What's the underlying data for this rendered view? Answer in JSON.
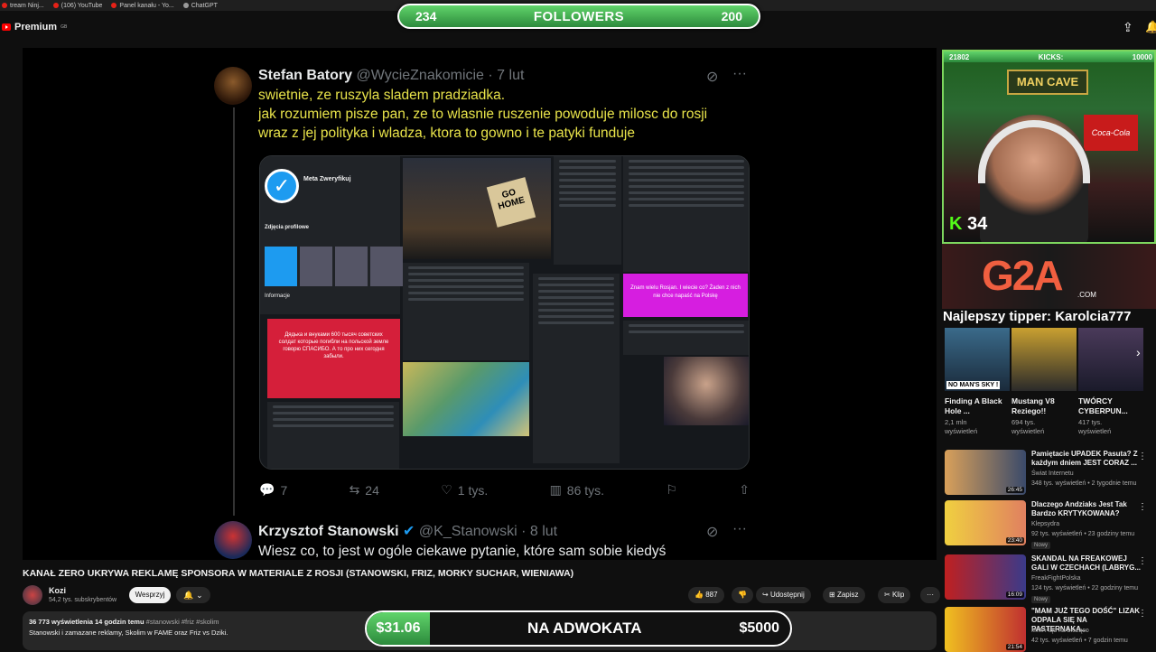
{
  "bookmarks": [
    "tream Ninj...",
    "(106) YouTube",
    "Panel kanału - Yo...",
    "ChatGPT"
  ],
  "header": {
    "logo": "Premium",
    "region": "GB"
  },
  "followers_goal": {
    "current": "234",
    "label": "FOLLOWERS",
    "target": "200"
  },
  "tweets": [
    {
      "name": "Stefan Batory",
      "handle": "@WycieZnakomicie · 7 lut",
      "lines": [
        "swietnie, ze ruszyla sladem pradziadka.",
        "jak rozumiem pisze pan, ze to wlasnie ruszenie powoduje milosc do rosji",
        "wraz z jej polityka i wladza, ktora to gowno i te patyki funduje"
      ],
      "stats": {
        "replies": "7",
        "retweets": "24",
        "likes": "1 tys.",
        "views": "86 tys."
      }
    },
    {
      "name": "Krzysztof Stanowski",
      "handle": "@K_Stanowski · 8 lut",
      "lines": [
        "Wiesz co, to jest w ogóle ciekawe pytanie, które sam sobie kiedyś"
      ]
    }
  ],
  "media": {
    "profile_name": "Meta Zweryfikuj",
    "section": "Zdjęcia profilowe",
    "info": "Informacje",
    "sign": "GO HOME",
    "red_text": "Дядька и внуками 600 тысяч советских солдат которые погибли на польской земле говорю СПАСИБО. А то про них сегодня забыли.",
    "magenta_text": "Znam wielu Rosjan. I wiecie co? Żaden z nich nie chce napaść na Polskę"
  },
  "video": {
    "title": "KANAŁ ZERO UKRYWA REKLAMĘ SPONSORA W MATERIALE Z ROSJI (STANOWSKI, FRIZ, MORKY SUCHAR, WIENIAWA)",
    "channel": "Kozi",
    "subs": "54,2 tys. subskrybentów",
    "support": "Wesprzyj",
    "likes": "887",
    "share": "Udostępnij",
    "save": "Zapisz",
    "clip": "Klip",
    "views": "36 773 wyświetlenia  14 godzin temu",
    "tags": "#stanowski #friz #skolim",
    "desc": "Stanowski i zamazane reklamy, Skolim w FAME oraz Friz vs Dziki."
  },
  "donation": {
    "current": "$31.06",
    "label": "NA ADWOKATA",
    "goal": "$5000"
  },
  "stream": {
    "kicks_left": "21802",
    "kicks_label": "KICKS:",
    "kicks_goal": "10000",
    "mancave": "MAN CAVE",
    "cola": "Coca-Cola",
    "kick_count": "34",
    "g2a": "G2A",
    "g2a_com": ".COM",
    "top_tipper": "Najlepszy tipper: Karolcia777"
  },
  "recommended": [
    {
      "title": "Finding A Black Hole ...",
      "meta1": "2,1 mln",
      "meta2": "wyświetleń",
      "badge": "NO MAN'S SKY !"
    },
    {
      "title": "Mustang V8 Reziego!!",
      "meta1": "694 tys.",
      "meta2": "wyświetleń"
    },
    {
      "title": "TWÓRCY CYBERPUN...",
      "meta1": "417 tys.",
      "meta2": "wyświetleń"
    }
  ],
  "side_videos": [
    {
      "title": "Pamiętacie UPADEK Pasuta? Z każdym dniem JEST CORAZ ...",
      "channel": "Świat Internetu",
      "meta": "348 tys. wyświetleń • 2 tygodnie temu",
      "duration": "26:45"
    },
    {
      "title": "Dlaczego Andziaks Jest Tak Bardzo KRYTYKOWANA?",
      "channel": "Klepsydra",
      "meta": "92 tys. wyświetleń • 23 godziny temu",
      "duration": "23:40",
      "badge": "Nowy"
    },
    {
      "title": "SKANDAL NA FREAKOWEJ GALI W CZECHACH (LABRYG...",
      "channel": "FreakFightPolska",
      "meta": "124 tys. wyświetleń • 22 godziny temu",
      "duration": "16:09",
      "badge": "Nowy"
    },
    {
      "title": "\"MAM JUŻ TEGO DOŚĆ\" LIZAK ODPALA SIĘ NA PASTERNAKA...",
      "channel": "MMA-ląd na bieżąco",
      "meta": "42 tys. wyświetleń • 7 godzin temu",
      "duration": "21:54"
    }
  ],
  "colors": {
    "accent_green": "#53fc18",
    "tweet_yellow": "#e8e34a",
    "bg": "#0f0f0f"
  }
}
